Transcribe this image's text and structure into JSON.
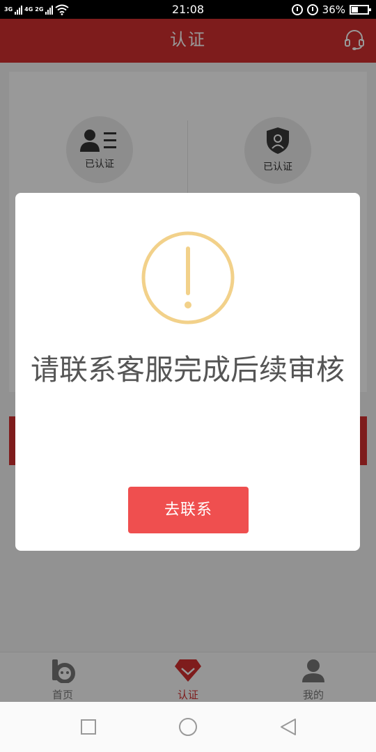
{
  "status_bar": {
    "network_top": "3G",
    "network_mid": "4G",
    "network_bottom": "2G",
    "time": "21:08",
    "battery": "36%"
  },
  "header": {
    "title": "认证"
  },
  "auth": {
    "items": [
      {
        "label": "已认证",
        "icon": "id-card-icon"
      },
      {
        "label": "已认证",
        "icon": "shield-person-icon"
      }
    ]
  },
  "bottom_nav": {
    "items": [
      {
        "label": "首页",
        "icon": "home-logo-icon"
      },
      {
        "label": "认证",
        "icon": "diamond-check-icon"
      },
      {
        "label": "我的",
        "icon": "user-icon"
      }
    ]
  },
  "dialog": {
    "message": "请联系客服完成后续审核",
    "button_label": "去联系"
  },
  "colors": {
    "brand_red": "#d32f2f",
    "button_red": "#ef4f4f",
    "warning_yellow": "#f2d18a"
  }
}
